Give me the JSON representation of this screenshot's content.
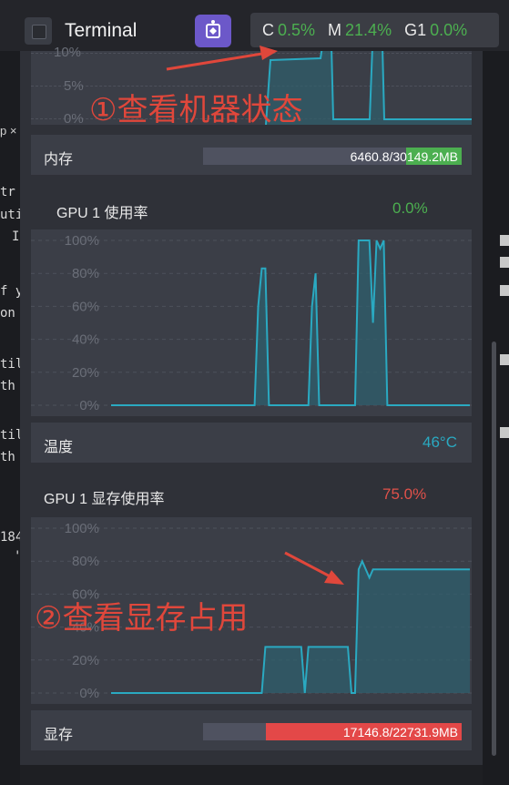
{
  "topbar": {
    "terminal_label": "Terminal",
    "stats": [
      {
        "key": "C",
        "value": "0.5%"
      },
      {
        "key": "M",
        "value": "21.4%"
      },
      {
        "key": "G1",
        "value": "0.0%"
      }
    ]
  },
  "left_code": {
    "tab_fragment": "p ×",
    "lines": [
      "tr",
      "uti",
      "I",
      "f y",
      "on",
      "til",
      "th",
      "til",
      "th",
      "184",
      "'"
    ]
  },
  "cpu_chart": {
    "y_ticks": [
      "10%",
      "5%",
      "0%"
    ]
  },
  "memory": {
    "label": "内存",
    "value_text": "6460.8/30149.2MB",
    "fill_color": "#4caf50",
    "used": 6460.8,
    "total": 30149.2
  },
  "gpu_usage": {
    "title": "GPU 1 使用率",
    "percent": "0.0%",
    "percent_color": "#4caf50",
    "y_ticks": [
      "100%",
      "80%",
      "60%",
      "40%",
      "20%",
      "0%"
    ]
  },
  "temperature": {
    "label": "温度",
    "value": "46°C",
    "color": "#2aa9c1"
  },
  "gpu_mem": {
    "title": "GPU 1 显存使用率",
    "percent": "75.0%",
    "percent_color": "#e0514a",
    "y_ticks": [
      "100%",
      "80%",
      "60%",
      "40%",
      "20%",
      "0%"
    ]
  },
  "vram": {
    "label": "显存",
    "value_text": "17146.8/22731.9MB",
    "fill_color": "#e34848",
    "used": 17146.8,
    "total": 22731.9
  },
  "annotations": {
    "first": "①查看机器状态",
    "second": "②查看显存占用"
  },
  "chart_data": [
    {
      "type": "area",
      "title": "GPU 1 使用率",
      "ylim": [
        0,
        100
      ],
      "x": [
        0,
        10,
        20,
        30,
        40,
        41,
        42,
        43,
        44,
        50,
        55,
        56,
        57,
        58,
        60,
        68,
        69,
        70,
        71,
        72,
        73,
        74,
        75,
        76,
        77,
        80,
        100
      ],
      "values": [
        0,
        0,
        0,
        0,
        0,
        60,
        83,
        83,
        0,
        0,
        0,
        60,
        80,
        0,
        0,
        0,
        100,
        100,
        100,
        100,
        50,
        100,
        95,
        100,
        0,
        0,
        0
      ]
    },
    {
      "type": "area",
      "title": "GPU 1 显存使用率",
      "ylim": [
        0,
        100
      ],
      "x": [
        0,
        10,
        20,
        30,
        42,
        43,
        53,
        54,
        55,
        56,
        66,
        67,
        68,
        69,
        70,
        71,
        72,
        73,
        74,
        75,
        100
      ],
      "values": [
        0,
        0,
        0,
        0,
        0,
        28,
        28,
        0,
        28,
        28,
        28,
        0,
        0,
        75,
        80,
        75,
        70,
        75,
        75,
        75,
        75
      ]
    }
  ]
}
